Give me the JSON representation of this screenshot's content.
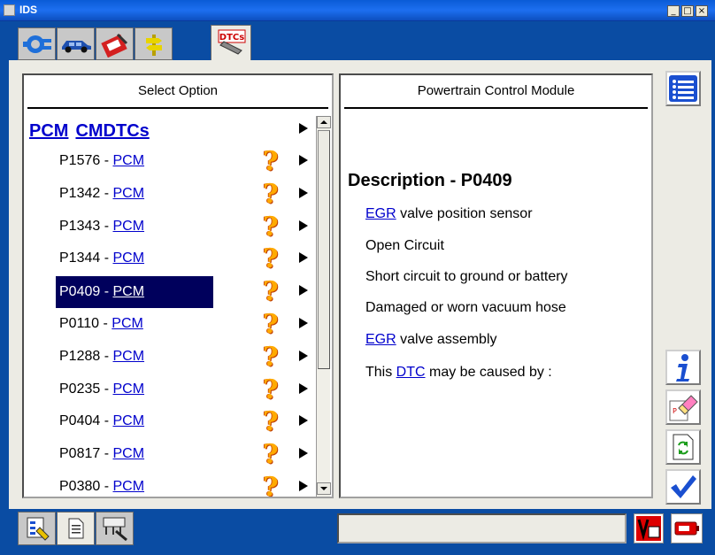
{
  "window": {
    "title": "IDS",
    "min": "_",
    "max": "□",
    "close": "×"
  },
  "top_tabs": [
    {
      "name": "connect-tab",
      "icon": "plug-icon"
    },
    {
      "name": "vehicle-tab",
      "icon": "car-icon"
    },
    {
      "name": "toolbox-tab",
      "icon": "toolbox-icon"
    },
    {
      "name": "directions-tab",
      "icon": "signpost-icon"
    }
  ],
  "dtc_tab": {
    "label": "DTCs"
  },
  "left_panel": {
    "header": "Select Option",
    "heading": {
      "module": "PCM",
      "label": "CMDTCs"
    },
    "rows": [
      {
        "code": "P1576",
        "module": "PCM"
      },
      {
        "code": "P1342",
        "module": "PCM"
      },
      {
        "code": "P1343",
        "module": "PCM"
      },
      {
        "code": "P1344",
        "module": "PCM"
      },
      {
        "code": "P0409",
        "module": "PCM",
        "selected": true
      },
      {
        "code": "P0110",
        "module": "PCM"
      },
      {
        "code": "P1288",
        "module": "PCM"
      },
      {
        "code": "P0235",
        "module": "PCM"
      },
      {
        "code": "P0404",
        "module": "PCM"
      },
      {
        "code": "P0817",
        "module": "PCM"
      },
      {
        "code": "P0380",
        "module": "PCM"
      }
    ],
    "separator": " - "
  },
  "right_panel": {
    "header": "Powertrain Control Module",
    "description_title": "Description - P0409",
    "lines": [
      {
        "link": "EGR",
        "text": " valve position sensor"
      },
      {
        "link": "",
        "text": "Open Circuit"
      },
      {
        "link": "",
        "text": "Short circuit to ground or battery"
      },
      {
        "link": "",
        "text": "Damaged or worn vacuum hose"
      },
      {
        "link": "EGR",
        "text": " valve assembly"
      },
      {
        "prefix": "This ",
        "link": "DTC",
        "text": " may be caused by :"
      }
    ]
  },
  "side_buttons": [
    "list-icon",
    "info-icon",
    "eraser-icon",
    "refresh-document-icon",
    "checkmark-icon"
  ],
  "bottom_tabs": [
    "notes-icon",
    "document-icon",
    "network-icon"
  ],
  "colors": {
    "frame": "#0a4ca3",
    "link": "#0000cc",
    "selected": "#00005c",
    "panel_bg": "#ecebe4"
  }
}
